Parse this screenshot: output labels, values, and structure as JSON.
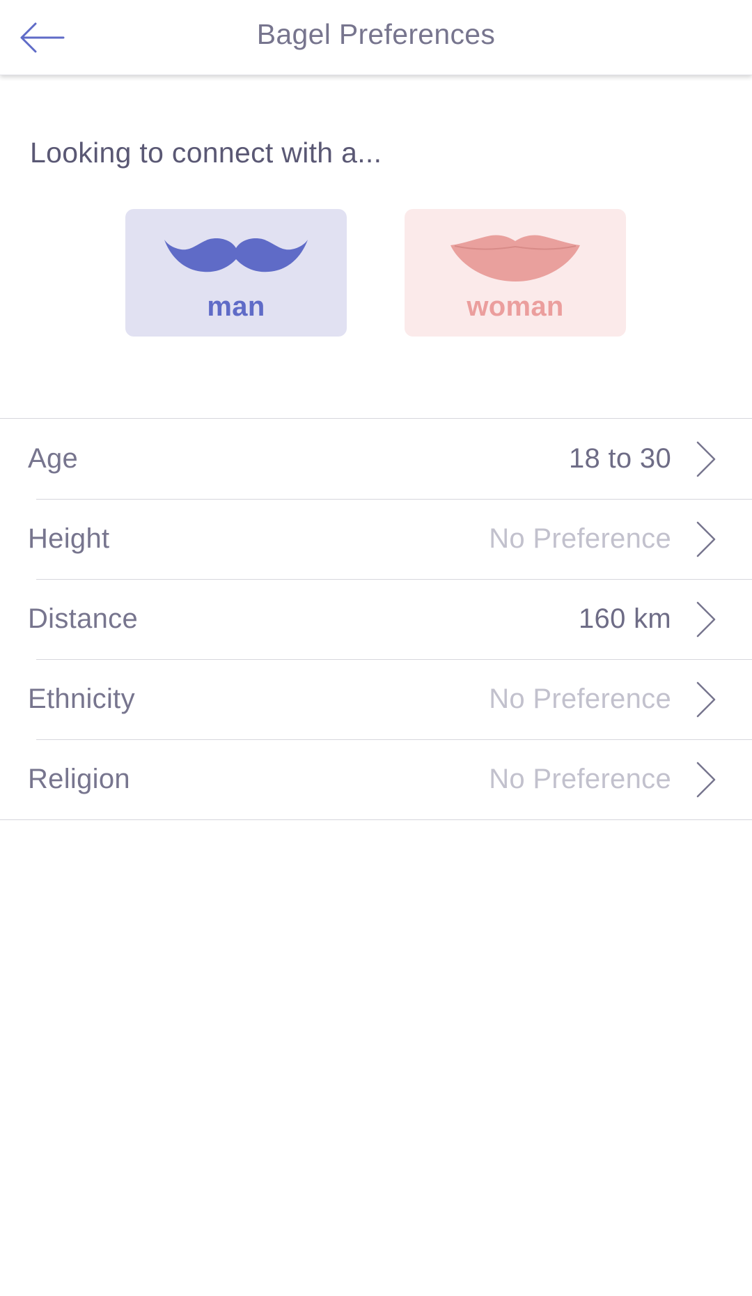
{
  "header": {
    "title": "Bagel Preferences",
    "back_icon": "arrow-left-icon"
  },
  "prompt": "Looking to connect with a...",
  "gender_options": [
    {
      "label": "man",
      "icon": "mustache-icon",
      "color": "#5f6bc7",
      "background": "#e1e1f2"
    },
    {
      "label": "woman",
      "icon": "lips-icon",
      "color": "#eb9e9d",
      "background": "#fbeaea"
    }
  ],
  "preferences": [
    {
      "label": "Age",
      "value": "18 to 30"
    },
    {
      "label": "Height",
      "value": "No Preference"
    },
    {
      "label": "Distance",
      "value": "160 km"
    },
    {
      "label": "Ethnicity",
      "value": "No Preference"
    },
    {
      "label": "Religion",
      "value": "No Preference"
    }
  ],
  "colors": {
    "accent": "#5f6bc7",
    "text": "#77758e",
    "muted": "#c2c1cd",
    "divider": "#d6d6dc"
  }
}
